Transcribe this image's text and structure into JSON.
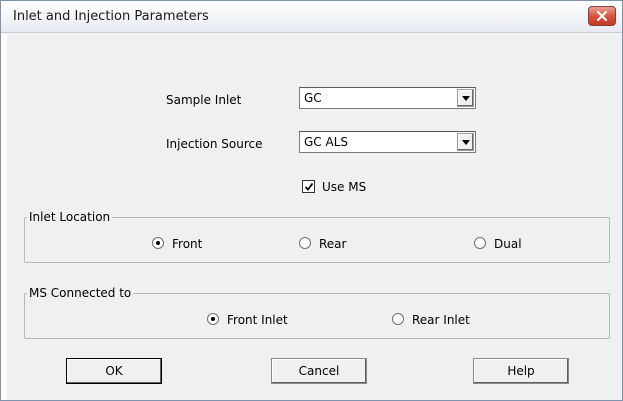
{
  "window": {
    "title": "Inlet and Injection Parameters"
  },
  "sample_inlet": {
    "label": "Sample Inlet",
    "value": "GC"
  },
  "injection_source": {
    "label": "Injection Source",
    "value": "GC ALS"
  },
  "use_ms": {
    "label": "Use MS",
    "checked": true
  },
  "inlet_location": {
    "legend": "Inlet Location",
    "options": [
      {
        "label": "Front",
        "selected": true
      },
      {
        "label": "Rear",
        "selected": false
      },
      {
        "label": "Dual",
        "selected": false
      }
    ]
  },
  "ms_connected": {
    "legend": "MS Connected to",
    "options": [
      {
        "label": "Front Inlet",
        "selected": true
      },
      {
        "label": "Rear Inlet",
        "selected": false
      }
    ]
  },
  "buttons": {
    "ok": "OK",
    "cancel": "Cancel",
    "help": "Help"
  }
}
